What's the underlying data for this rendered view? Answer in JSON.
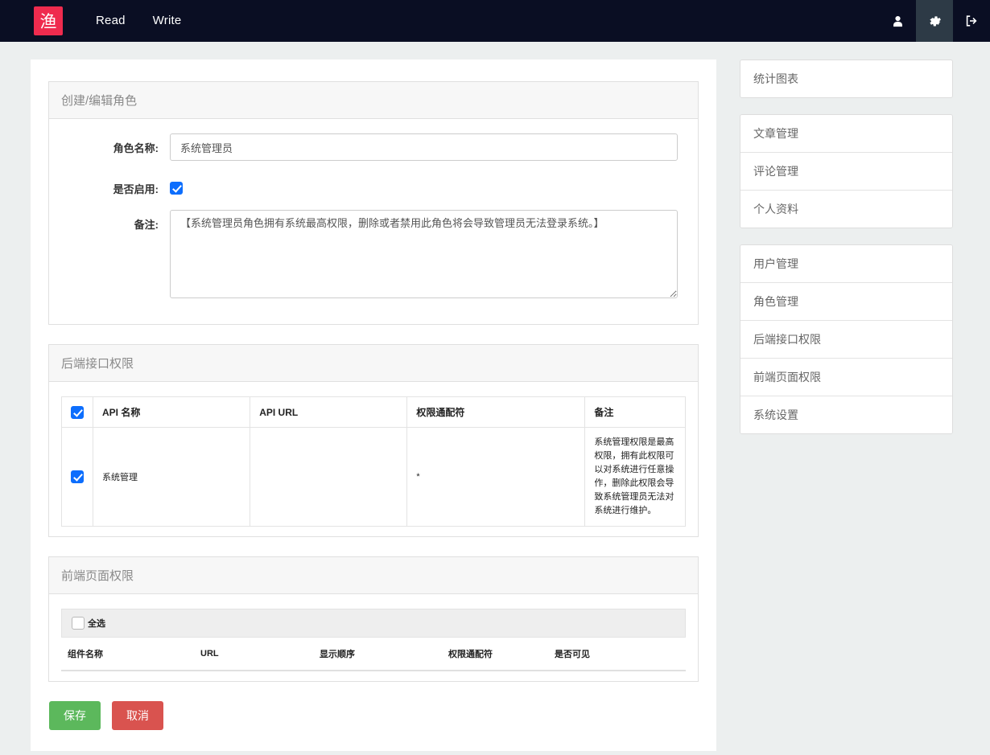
{
  "navbar": {
    "logo_text": "渔",
    "links": [
      {
        "label": "Read"
      },
      {
        "label": "Write"
      }
    ],
    "icons": [
      {
        "name": "user-icon",
        "active": false
      },
      {
        "name": "gear-icon",
        "active": true
      },
      {
        "name": "logout-icon",
        "active": false
      }
    ],
    "bg_color": "#0a0e23",
    "logo_color": "#ef2b4e",
    "active_icon_bg": "#2d3a46"
  },
  "role_form": {
    "panel_title": "创建/编辑角色",
    "fields": {
      "name_label": "角色名称:",
      "name_value": "系统管理员",
      "name_placeholder": "",
      "enabled_label": "是否启用:",
      "enabled_checked": true,
      "remark_label": "备注:",
      "remark_value": "【系统管理员角色拥有系统最高权限，删除或者禁用此角色将会导致管理员无法登录系统。】",
      "remark_placeholder": ""
    }
  },
  "api_permission": {
    "panel_title": "后端接口权限",
    "header_checkbox_checked": true,
    "columns": [
      "API 名称",
      "API URL",
      "权限通配符",
      "备注"
    ],
    "rows": [
      {
        "checked": true,
        "name": "系统管理",
        "url": "",
        "wildcard": "*",
        "remark": "系统管理权限是最高权限，拥有此权限可以对系统进行任意操作，删除此权限会导致系统管理员无法对系统进行维护。"
      }
    ]
  },
  "page_permission": {
    "panel_title": "前端页面权限",
    "select_all_label": "全选",
    "select_all_checked": false,
    "columns": [
      "组件名称",
      "URL",
      "显示顺序",
      "权限通配符",
      "是否可见"
    ],
    "rows": []
  },
  "actions": {
    "save_label": "保存",
    "cancel_label": "取消",
    "save_color": "#5cb85c",
    "cancel_color": "#d9534f"
  },
  "sidebar": {
    "groups": [
      {
        "items": [
          {
            "label": "统计图表"
          }
        ]
      },
      {
        "items": [
          {
            "label": "文章管理"
          },
          {
            "label": "评论管理"
          },
          {
            "label": "个人资料"
          }
        ]
      },
      {
        "items": [
          {
            "label": "用户管理"
          },
          {
            "label": "角色管理"
          },
          {
            "label": "后端接口权限"
          },
          {
            "label": "前端页面权限"
          },
          {
            "label": "系统设置"
          }
        ]
      }
    ]
  }
}
